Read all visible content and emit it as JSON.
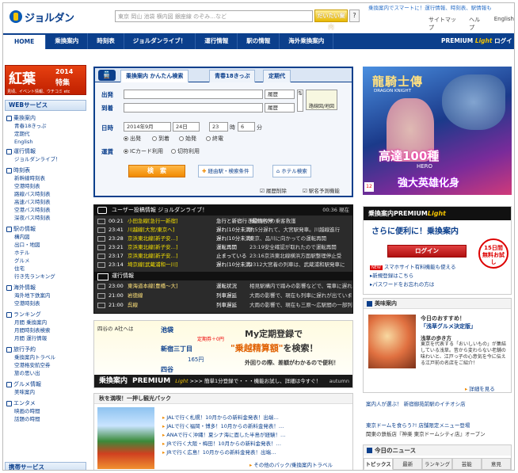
{
  "header": {
    "logo": "ジョルダン",
    "tagline": "乗換案内でスマートに！運行情報、時刻表、駅情報も",
    "search_placeholder": "東京 岡山 池袋 横内図 銀座線 のぞみ…など",
    "search_button": "だいたい案内",
    "help": "?",
    "links": [
      "サイトマップ",
      "ヘルプ",
      "English"
    ]
  },
  "nav": {
    "items": [
      "HOME",
      "乗換案内",
      "時刻表",
      "ジョルダンライブ！",
      "運行情報",
      "駅の情報",
      "海外乗換案内"
    ],
    "premium_login": "ログイン",
    "premium_brand": "PREMIUM",
    "premium_light": "Light"
  },
  "sidebar": {
    "banner": {
      "title": "紅葉",
      "year": "2014",
      "sub": "特集",
      "desc": "見頃、イベント情報、ウチコミ etc"
    },
    "web_services_title": "WEBサービス",
    "groups": [
      {
        "label": "乗換案内",
        "items": [
          "青春18きっぷ",
          "定期代",
          "English"
        ]
      },
      {
        "label": "運行情報",
        "items": [
          "ジョルダンライブ！"
        ]
      },
      {
        "label": "時刻表",
        "items": [
          "新幹線時刻表",
          "空港時刻表",
          "路線バス時刻表",
          "高速バス時刻表",
          "空港バス時刻表",
          "深夜バス時刻表"
        ]
      },
      {
        "label": "駅の情報",
        "items": [
          "構内図",
          "出口・地図",
          "ホテル",
          "グルメ",
          "住宅",
          "行き先ランキング"
        ]
      },
      {
        "label": "海外情報",
        "items": [
          "海外地下鉄案内",
          "空港時刻表"
        ]
      },
      {
        "label": "ランキング",
        "items": [
          "月間 乗換案内",
          "月間時刻表検索",
          "月間 運行情報"
        ]
      },
      {
        "label": "旅行予約",
        "items": [
          "乗換案内トラベル",
          "空港格安航空券",
          "旅の思い出"
        ]
      },
      {
        "label": "グルメ情報",
        "items": [
          "美味案内"
        ]
      },
      {
        "label": "エンタメ",
        "items": [
          "映画の時間",
          "話題の時間"
        ]
      }
    ],
    "mobile_title": "携帯サービス"
  },
  "route": {
    "icon": "train-icon",
    "tabs": [
      "乗換案内 かんたん検索",
      "青春18きっぷ",
      "定期代"
    ],
    "from_label": "出発",
    "to_label": "到着",
    "history": "履歴",
    "map_button": "路線図/地図",
    "date_label": "日時",
    "year_month": "2014年9月",
    "day": "24日",
    "hour": "23",
    "hour_unit": "時",
    "minute": "6",
    "minute_unit": "分",
    "time_options": [
      "出発",
      "到着",
      "始発",
      "終電"
    ],
    "route_label": "運賃",
    "fare_options": [
      "ICカード利用",
      "切符利用"
    ],
    "search_button": "検　索",
    "via_button": "経由駅・検索条件",
    "hotel_button": "ホテル検索",
    "history_delete": "履歴削除",
    "station_predict": "駅名予測機能"
  },
  "ad": {
    "title": "龍騎士傳",
    "subtitle": "DRAGON KNIGHT",
    "main": "高達100種",
    "hero": "HERO",
    "bottom": "強大英雄化身",
    "age": "12"
  },
  "posts": {
    "title": "ユーザー投稿情報 ジョルダンライブ！",
    "time": "00:36 現在",
    "rows": [
      {
        "time": "00:21",
        "line": "小田急線[急行一新宿]",
        "status": "急行と新宿行き最終各停",
        "msg": "藤沢駅での乗客救護"
      },
      {
        "time": "23:41",
        "line": "川越線[大宮/東京へ]",
        "status": "遅れ(10分未満)",
        "msg": "約5分遅れて、大宮駅発車。川越線進行"
      },
      {
        "time": "23:28",
        "line": "京浜東北線[新子安…]",
        "status": "遅れ(10分未満)",
        "msg": "東京、品川に向かっての運転再開"
      },
      {
        "time": "23:21",
        "line": "京浜東北線[新子安…]",
        "status": "運転再開",
        "msg": "23:19安全確認が取れたので運転再開"
      },
      {
        "time": "23:17",
        "line": "京浜東北線[新子安…]",
        "status": "止まっている",
        "msg": "23:16京浜東北線横浜方面駅整理停止受"
      },
      {
        "time": "23:14",
        "line": "埼京線[武蔵浦和一川]",
        "status": "遅れ(10分未満)",
        "msg": "2312大宮着の列車は、武蔵浦和駅発車に"
      }
    ],
    "ops_title": "運行情報",
    "ops": [
      {
        "time": "23:00",
        "line": "東海道本線[豊橋～大]",
        "status": "運転状況",
        "msg": "相見駅構内で踏みの影響などで、電車に遅れ"
      },
      {
        "time": "21:00",
        "line": "岩徳線",
        "status": "列車遅延",
        "msg": "大雨の影響で、現在も列車に遅れが出ています"
      },
      {
        "time": "21:00",
        "line": "呉線",
        "status": "列車遅延",
        "msg": "大雨の影響で、現在も三原～広駅間の一部列車に遅れ"
      }
    ]
  },
  "teiki": {
    "question": "四谷の A社へは",
    "stations": [
      "池袋",
      "新宿三丁目"
    ],
    "note": "定期券＋0円",
    "fare": "165円",
    "station3": "四谷",
    "headline": "My定期登録で",
    "big": "\"乗越精算額\"",
    "big_suffix": "を検索！",
    "desc": "外回りの際、差額がわかるので便利！",
    "bar_brand": "乗換案内",
    "bar_prem": "PREMIUM",
    "bar_light": "Light",
    "bar_text": ">>> 簡単1分登録で・・・機能お試し、詳細は今すぐ！",
    "bar_mark": "autumn"
  },
  "pack": {
    "title": "秋を満喫！一押し観光パック",
    "items": [
      "JALで行く札幌！10月からの新料金発表！出端…",
      "JALで行く福岡・博多！10月からの新料金発表！…",
      "ANAで行く沖縄！夏シナ海に面した半島が経験！…",
      "JRで行く大阪・梅田！10月からの新料金発表！…",
      "JRで行く広島！10月からの新料金発表！出端…"
    ],
    "more": "その他のパック/乗換案内トラベル"
  },
  "premium": {
    "brand": "乗換案内",
    "prem": "PREMIUM",
    "light": "Light",
    "line": "さらに便利に！乗換案内",
    "login": "ログイン",
    "badge_a": "15日間",
    "badge_b": "無料お試し",
    "links": [
      "スマホサイト有料機能も使える",
      "新規登録はこちら",
      "パスワードをお忘れの方は"
    ],
    "new_label": "NEW"
  },
  "gourmet": {
    "title": "美味案内",
    "t1": "今日のおすすめ！",
    "t2": "「浅草グルメ決定版」",
    "t3": "浅草の歩き方",
    "desc": "東京を代表する「おいしいもの」が集結している浅草。昔から変わらない老舗の味わいと、江戸っ子の心意気を今に伝える江戸前の名店をご紹介！",
    "more": "詳細を見る",
    "promos": [
      {
        "a": "案内人が選ぶ！ 新宿御苑前駅のイチオシ店",
        "b": ""
      },
      {
        "a": "東京ドームを食らう?! 店舗限定メニュー登場",
        "b": "関東の鉄板店『神楽 東京ドームシティ店』オープン"
      }
    ]
  },
  "news": {
    "title": "今日のニュース",
    "tabs": [
      "トピックス",
      "最新",
      "ランキング",
      "芸能",
      "意見"
    ]
  }
}
